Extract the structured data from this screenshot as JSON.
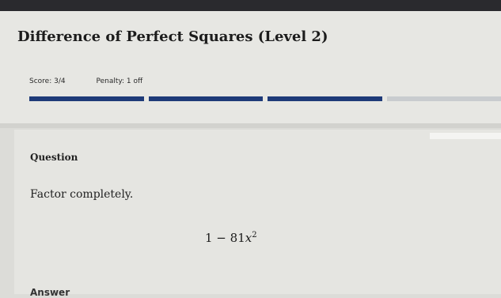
{
  "header": {
    "title": "Difference of Perfect Squares (Level 2)"
  },
  "status": {
    "score": "Score: 3/4",
    "penalty": "Penalty: 1 off"
  },
  "progress": {
    "filled_segments": 3,
    "total_segments": 4
  },
  "colors": {
    "progress_filled": "#1e3a78",
    "progress_empty": "#c9cccf"
  },
  "question": {
    "label": "Question",
    "text": "Factor completely.",
    "expression": {
      "lead": "1 − 81",
      "variable": "x",
      "exponent": "2"
    }
  },
  "answer": {
    "label": "Answer"
  }
}
